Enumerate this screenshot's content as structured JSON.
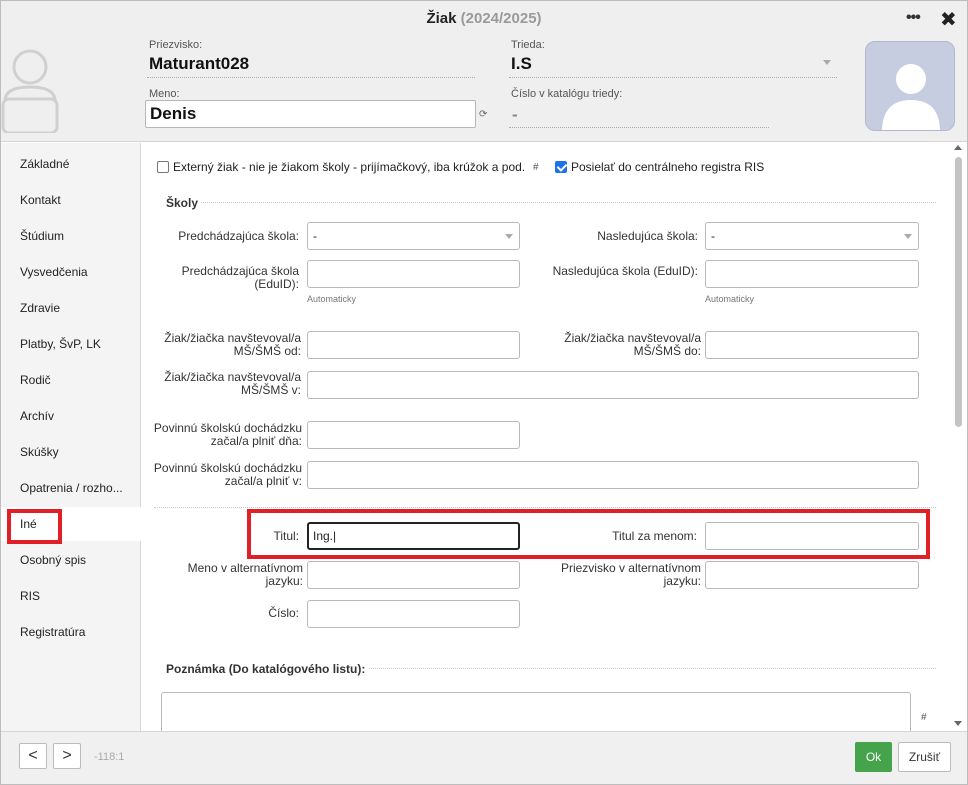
{
  "window": {
    "title": "Žiak",
    "year": "(2024/2025)",
    "more_icon": "ellipsis-icon",
    "close_icon": "close-icon"
  },
  "header": {
    "surname_label": "Priezvisko:",
    "surname_value": "Maturant028",
    "class_label": "Trieda:",
    "class_value": "I.S",
    "name_label": "Meno:",
    "name_value": "Denis",
    "catalog_label": "Číslo v katalógu triedy:",
    "catalog_value": "-"
  },
  "sidebar": {
    "items": [
      {
        "label": "Základné"
      },
      {
        "label": "Kontakt"
      },
      {
        "label": "Štúdium"
      },
      {
        "label": "Vysvedčenia"
      },
      {
        "label": "Zdravie"
      },
      {
        "label": "Platby, ŠvP, LK"
      },
      {
        "label": "Rodič"
      },
      {
        "label": "Archív"
      },
      {
        "label": "Skúšky"
      },
      {
        "label": "Opatrenia / rozho..."
      },
      {
        "label": "Iné"
      },
      {
        "label": "Osobný spis"
      },
      {
        "label": "RIS"
      },
      {
        "label": "Registratúra"
      }
    ],
    "active_index": 10
  },
  "content": {
    "external_checkbox_label": "Externý žiak - nie je žiakom školy - prijímačkový, iba krúžok a pod.",
    "external_checked": false,
    "hash_symbol": "#",
    "ris_checkbox_label": "Posielať do centrálneho registra RIS",
    "ris_checked": true,
    "schools_section": "Školy",
    "prev_school_label": "Predchádzajúca škola:",
    "prev_school_value": "-",
    "next_school_label": "Nasledujúca škola:",
    "next_school_value": "-",
    "prev_school_eduid_label": "Predchádzajúca škola (EduID):",
    "next_school_eduid_label": "Nasledujúca škola (EduID):",
    "auto_hint": "Automaticky",
    "ms_from_label": "Žiak/žiačka navštevoval/a MŠ/ŠMŠ od:",
    "ms_to_label": "Žiak/žiačka navštevoval/a MŠ/ŠMŠ do:",
    "ms_in_label": "Žiak/žiačka navštevoval/a MŠ/ŠMŠ v:",
    "duty_day_label": "Povinnú školskú dochádzku začal/a plniť dňa:",
    "duty_in_label": "Povinnú školskú dochádzku začal/a plniť v:",
    "title_label": "Titul:",
    "title_value": "Ing.|",
    "title_after_label": "Titul za menom:",
    "title_after_value": "",
    "alt_name_label": "Meno v alternatívnom jazyku:",
    "alt_surname_label": "Priezvisko v alternatívnom jazyku:",
    "number_label": "Číslo:",
    "note_section": "Poznámka (Do katalógového listu):"
  },
  "footer": {
    "prev": "<",
    "next": ">",
    "counter": "-118:1",
    "ok": "Ok",
    "cancel": "Zrušiť"
  },
  "colors": {
    "highlight": "#e01f26",
    "ok_button": "#45a34b",
    "checkbox_on": "#1a73e8"
  }
}
